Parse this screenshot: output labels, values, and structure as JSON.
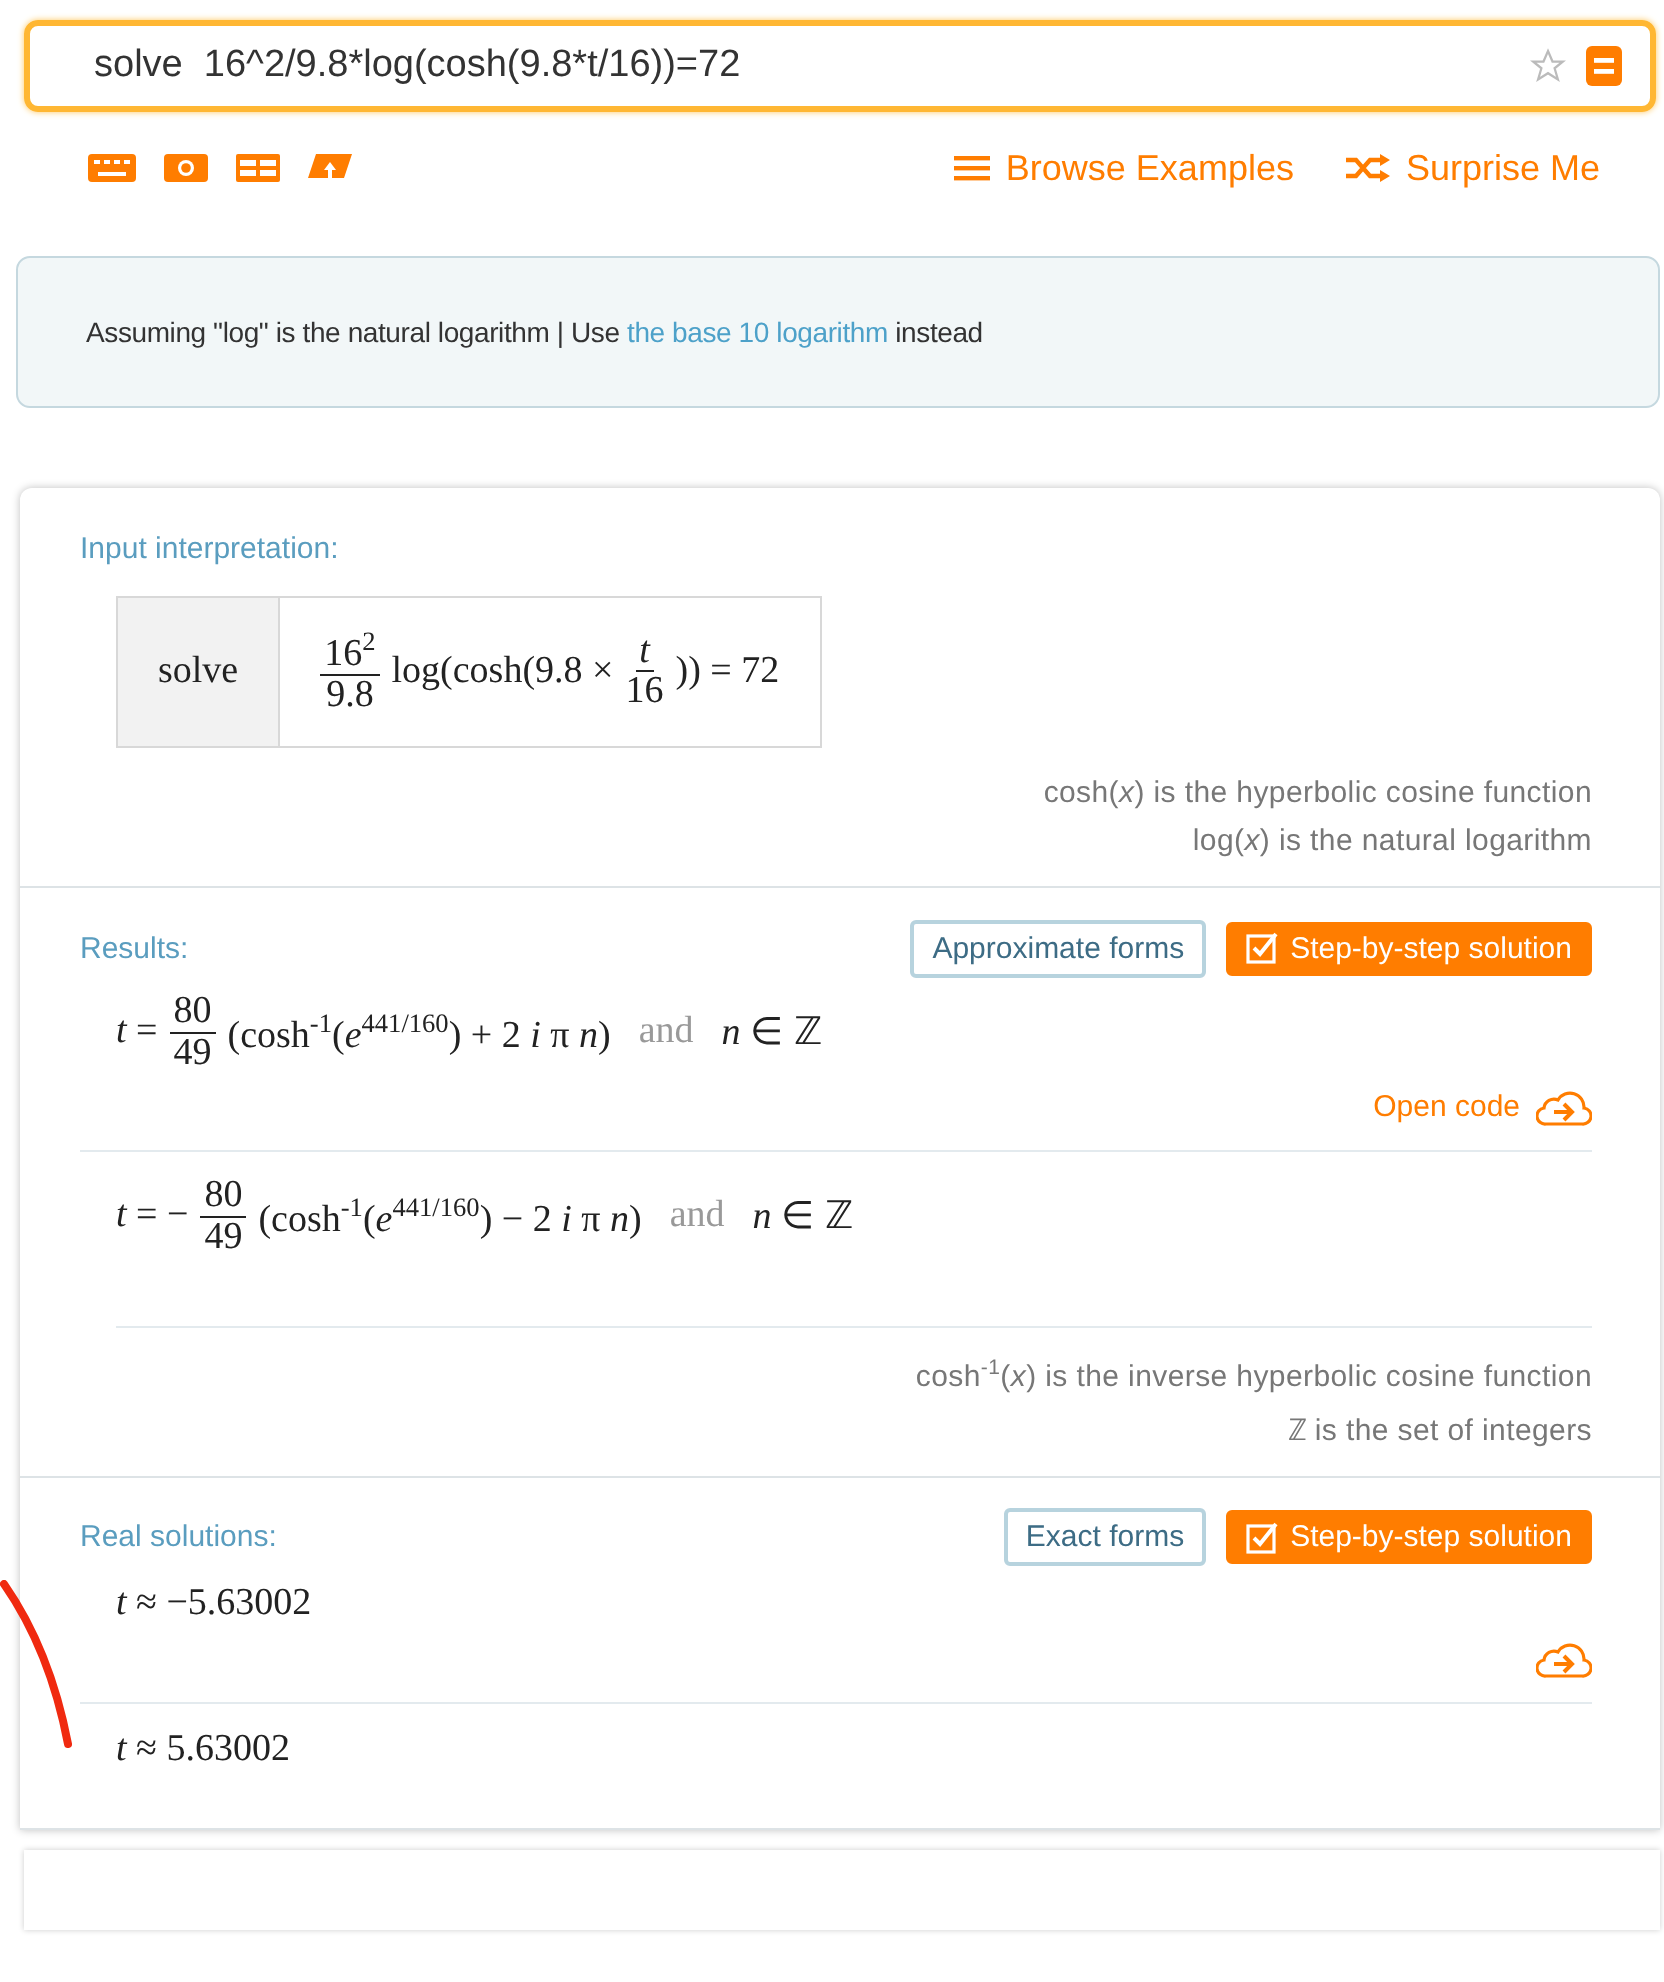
{
  "search": {
    "value": "solve  16^2/9.8*log(cosh(9.8*t/16))=72"
  },
  "toolbar": {
    "links": [
      {
        "kind": "browse",
        "label": "Browse Examples"
      },
      {
        "kind": "surprise",
        "label": "Surprise Me"
      }
    ]
  },
  "assumption": {
    "text": "Assuming \"log\" is the natural logarithm | Use ",
    "link": "the base 10 logarithm",
    "suffix": " instead"
  },
  "pods": [
    {
      "title": "Input interpretation:",
      "input": {
        "label": "solve",
        "formula": [
          {
            "kind": "frac",
            "num": "16$^{2}$",
            "den": "9.8"
          },
          {
            "kind": "math",
            "text": "log(cosh(9.8 ×"
          },
          {
            "kind": "frac",
            "num": "*t*",
            "den": "16"
          },
          {
            "kind": "math",
            "text": ")) = 72"
          }
        ]
      },
      "notes": [
        "cosh(*x*) is the hyperbolic cosine function",
        "log(*x*) is the natural logarithm"
      ]
    },
    {
      "title": "Results:",
      "buttons": [
        {
          "kind": "outline",
          "label": "Approximate forms"
        },
        {
          "kind": "primary",
          "label": "Step-by-step solution"
        }
      ],
      "results": [
        {
          "formula": [
            {
              "kind": "math",
              "text": "*t* ="
            },
            {
              "kind": "frac",
              "num": "80",
              "den": "49"
            },
            {
              "kind": "math",
              "text": "(cosh$^{-1}$(*e*$^{441/160}$) + 2 *i* π *n*)"
            },
            {
              "kind": "word",
              "text": "and"
            },
            {
              "kind": "math",
              "text": "*n* ∈ ℤ"
            }
          ],
          "share_icon": true,
          "open_code": "Open code"
        },
        {
          "formula": [
            {
              "kind": "math",
              "text": "*t* = −"
            },
            {
              "kind": "frac",
              "num": "80",
              "den": "49"
            },
            {
              "kind": "math",
              "text": "(cosh$^{-1}$(*e*$^{441/160}$) − 2 *i* π *n*)"
            },
            {
              "kind": "word",
              "text": "and"
            },
            {
              "kind": "math",
              "text": "*n* ∈ ℤ"
            }
          ],
          "share_icon": false
        }
      ],
      "notes": [
        "cosh$^{-1}$(*x*) is the inverse hyperbolic cosine function",
        "ℤ is the set of integers"
      ]
    },
    {
      "title": "Real solutions:",
      "buttons": [
        {
          "kind": "outline",
          "label": "Exact forms"
        },
        {
          "kind": "primary",
          "label": "Step-by-step solution"
        }
      ],
      "results": [
        {
          "formula": [
            {
              "kind": "math",
              "text": "*t* ≈ −5.63002"
            }
          ],
          "share_icon": true
        },
        {
          "formula": [
            {
              "kind": "math",
              "text": "*t* ≈ 5.63002"
            }
          ],
          "share_icon": false
        }
      ]
    }
  ]
}
